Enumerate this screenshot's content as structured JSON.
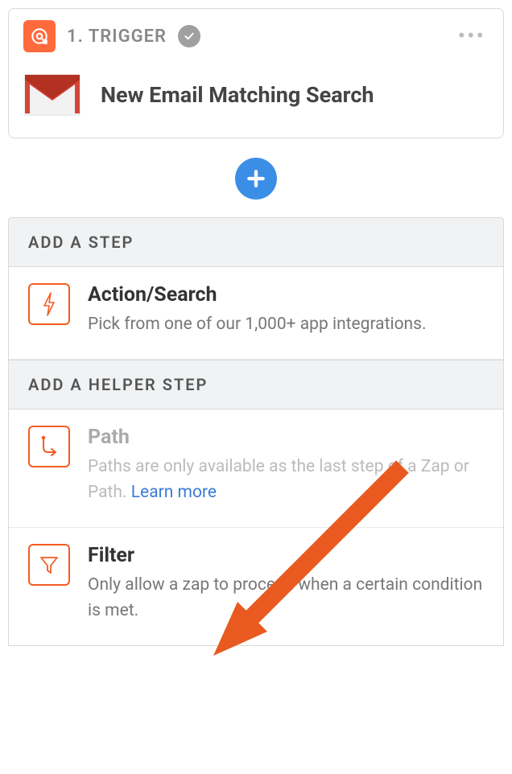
{
  "trigger": {
    "step_label": "1. TRIGGER",
    "title": "New Email Matching Search"
  },
  "sections": {
    "add_step_header": "ADD A STEP",
    "add_helper_header": "ADD A HELPER STEP"
  },
  "steps": {
    "action": {
      "title": "Action/Search",
      "desc": "Pick from one of our 1,000+ app integrations."
    },
    "path": {
      "title": "Path",
      "desc_prefix": "Paths are only available as the last step of a Zap or Path. ",
      "learn_more": "Learn more"
    },
    "filter": {
      "title": "Filter",
      "desc": "Only allow a zap to proceed when a certain condition is met."
    }
  }
}
